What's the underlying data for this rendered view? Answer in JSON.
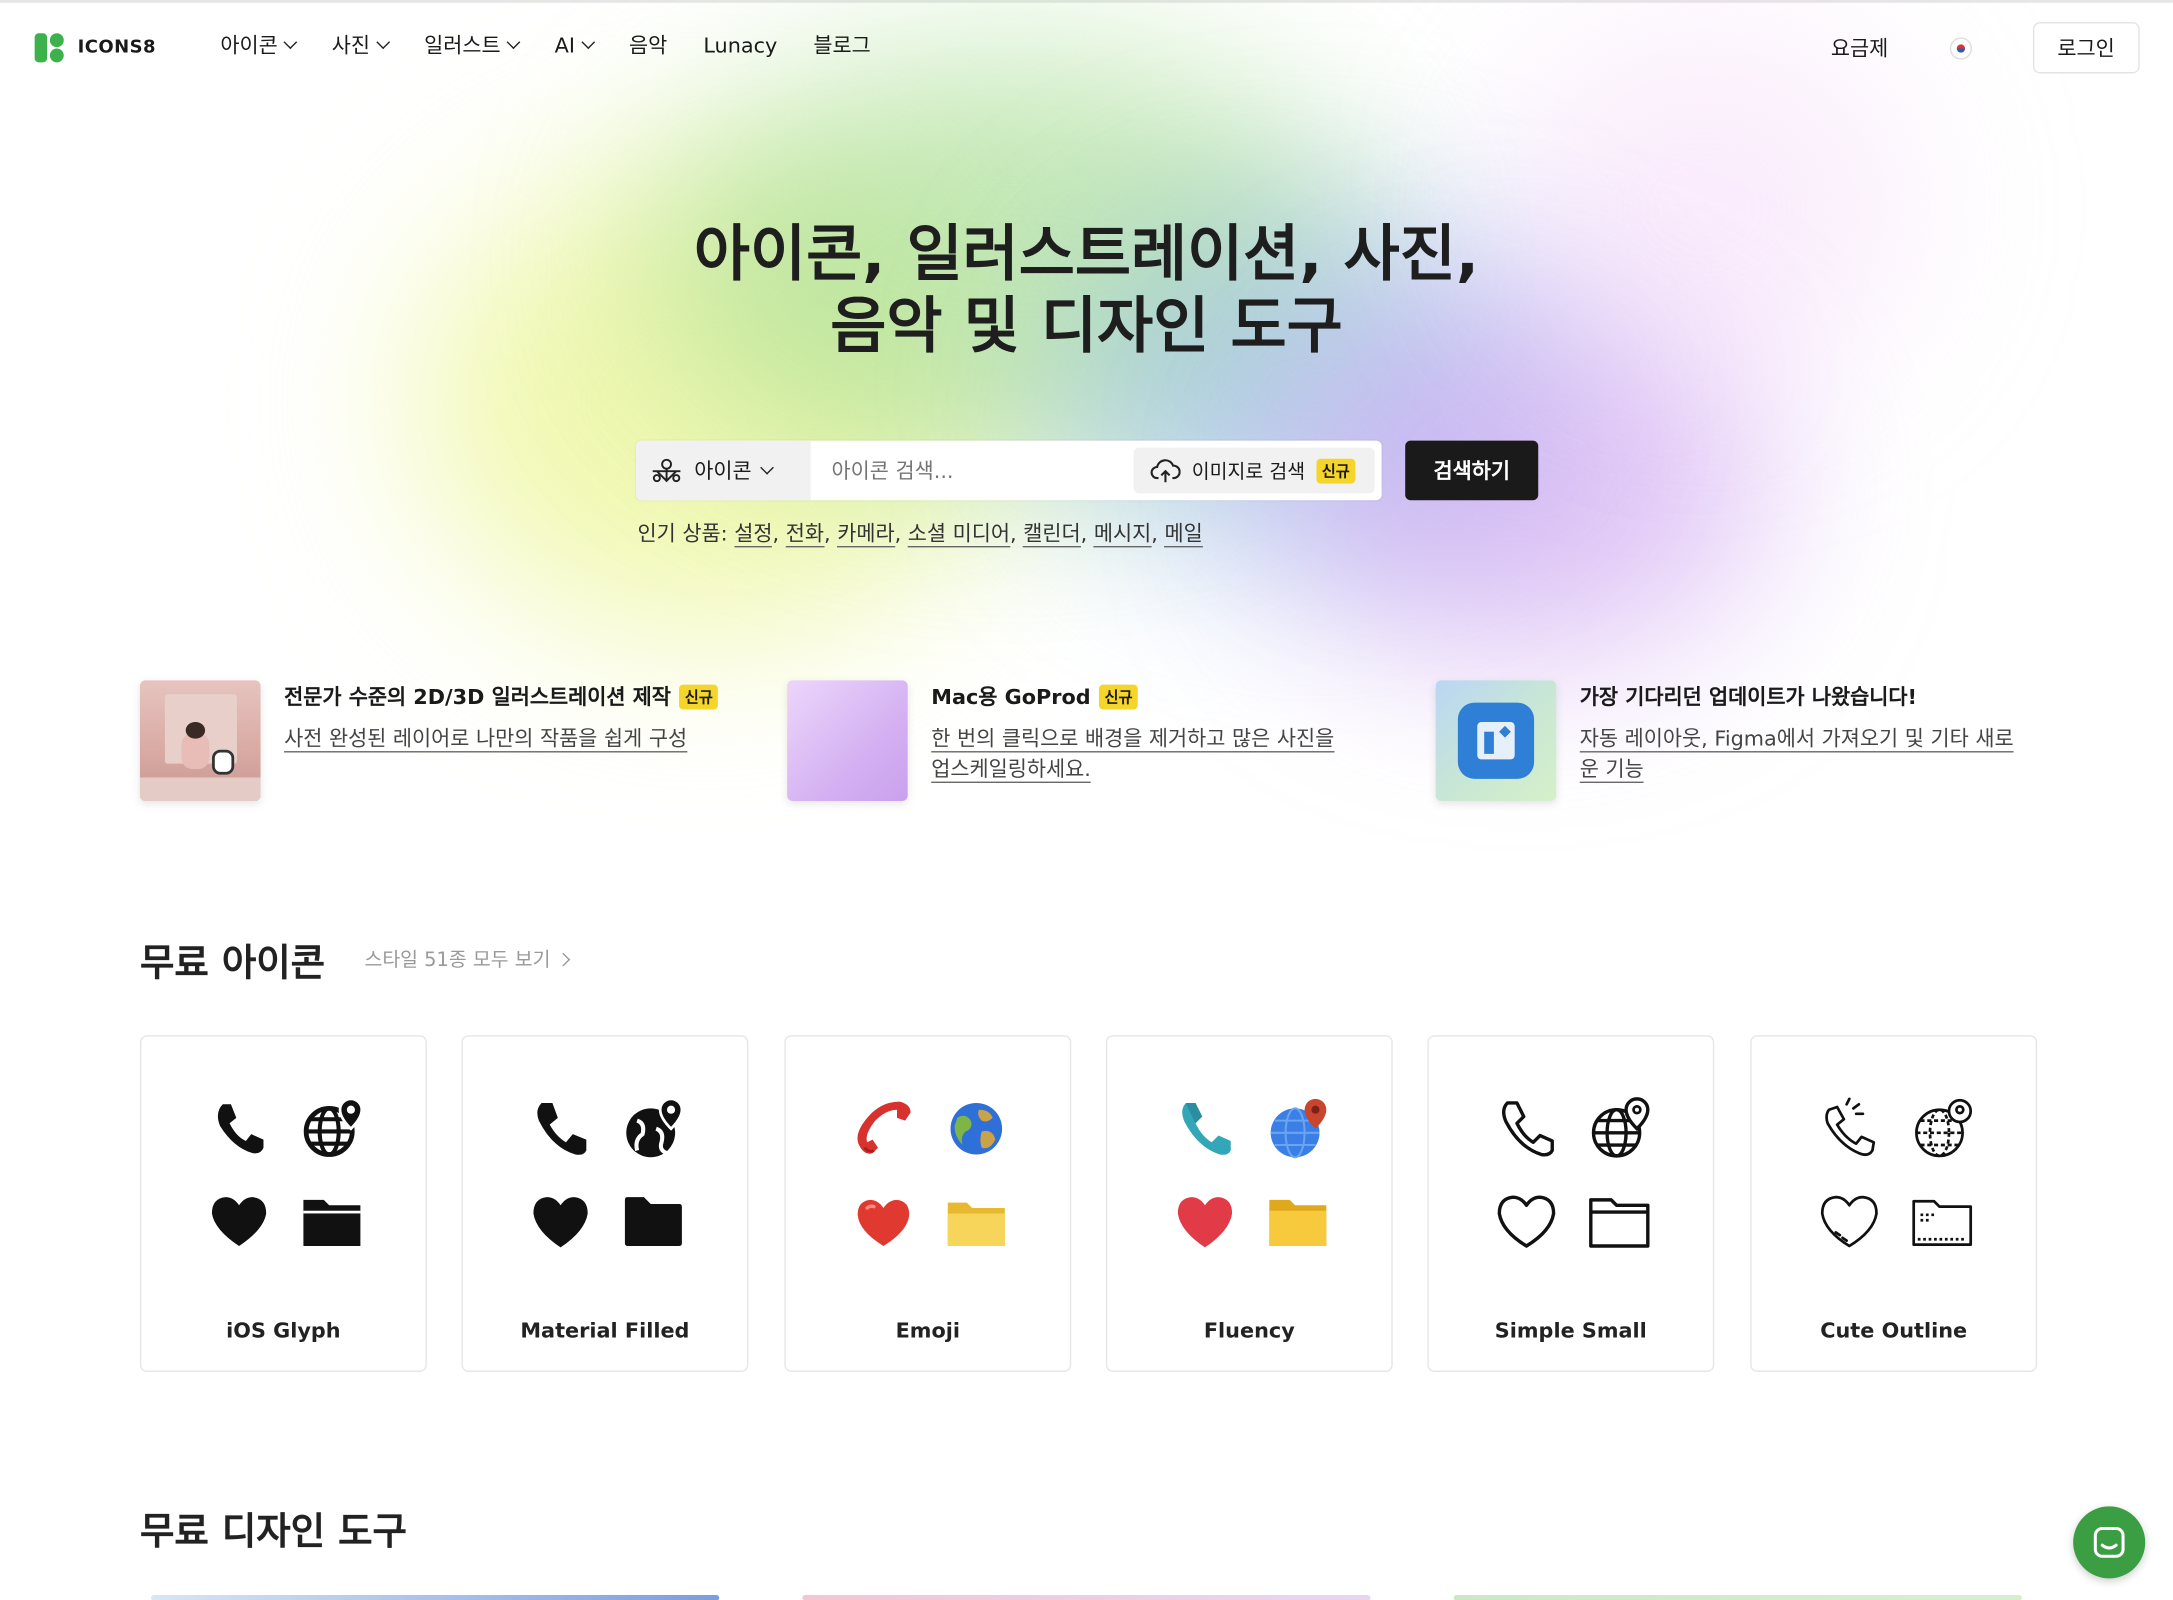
{
  "header": {
    "logo_text": "ICONS8",
    "nav": [
      {
        "label": "아이콘",
        "dropdown": true
      },
      {
        "label": "사진",
        "dropdown": true
      },
      {
        "label": "일러스트",
        "dropdown": true
      },
      {
        "label": "AI",
        "dropdown": true
      },
      {
        "label": "음악",
        "dropdown": false
      },
      {
        "label": "Lunacy",
        "dropdown": false
      },
      {
        "label": "블로그",
        "dropdown": false
      }
    ],
    "pricing": "요금제",
    "login": "로그인"
  },
  "hero": {
    "title_line1": "아이콘, 일러스트레이션, 사진,",
    "title_line2": "음악 및 디자인 도구"
  },
  "search": {
    "type_label": "아이콘",
    "placeholder": "아이콘 검색...",
    "image_search_label": "이미지로 검색",
    "new_badge": "신규",
    "button_label": "검색하기",
    "popular_prefix": "인기 상품:",
    "popular": [
      "설정",
      "전화",
      "카메라",
      "소셜 미디어",
      "캘린더",
      "메시지",
      "메일"
    ]
  },
  "promos": [
    {
      "title": "전문가 수준의 2D/3D 일러스트레이션 제작",
      "badge": "신규",
      "desc": "사전 완성된 레이어로 나만의 작품을 쉽게 구성"
    },
    {
      "title": "Mac용 GoProd",
      "badge": "신규",
      "desc1": "한 번의 클릭으로 배경을 제거하고 많은 사진을",
      "desc2": "업스케일링하세요."
    },
    {
      "title": "가장 기다리던 업데이트가 나왔습니다!",
      "badge": "",
      "desc1": "자동 레이아웃, Figma에서 가져오기 및 기타 새로",
      "desc2": "운 기능"
    }
  ],
  "free_icons": {
    "title": "무료 아이콘",
    "link": "스타일 51종 모두 보기",
    "styles": [
      "iOS Glyph",
      "Material Filled",
      "Emoji",
      "Fluency",
      "Simple Small",
      "Cute Outline"
    ]
  },
  "design_tools": {
    "title": "무료 디자인 도구"
  },
  "colors": {
    "accent_green": "#3db14c",
    "badge_yellow": "#f5d52a",
    "button_dark": "#1a1a1a"
  }
}
